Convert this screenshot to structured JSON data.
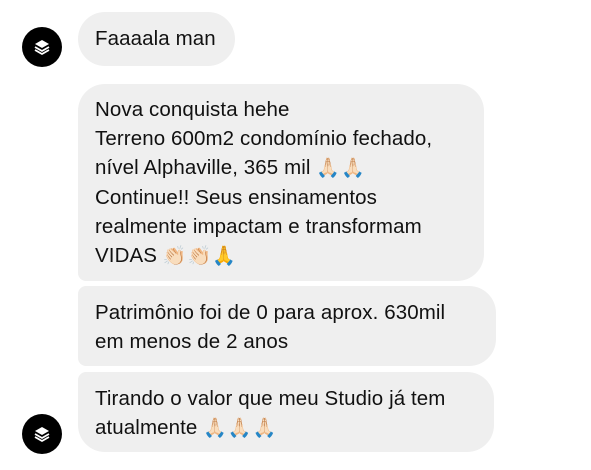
{
  "messages": [
    {
      "sender": "other",
      "lines": [
        {
          "text": "Faaaala man",
          "emoji": ""
        }
      ]
    },
    {
      "sender": "other",
      "lines": [
        {
          "text": "Nova conquista hehe",
          "emoji": ""
        },
        {
          "text": "Terreno 600m2 condomínio fechado,",
          "emoji": ""
        },
        {
          "text": "nível Alphaville, 365 mil",
          "emoji": "🙏🏻🙏🏻"
        },
        {
          "text": "Continue!! Seus ensinamentos",
          "emoji": ""
        },
        {
          "text": "realmente impactam e transformam",
          "emoji": ""
        },
        {
          "text": "VIDAS",
          "emoji": "👏🏻👏🏻🙏"
        }
      ]
    },
    {
      "sender": "other",
      "lines": [
        {
          "text": "Patrimônio foi de 0 para aprox. 630mil",
          "emoji": ""
        },
        {
          "text": "em menos de 2 anos",
          "emoji": ""
        }
      ]
    },
    {
      "sender": "other",
      "lines": [
        {
          "text": "Tirando o valor que meu Studio já tem",
          "emoji": ""
        },
        {
          "text": "atualmente",
          "emoji": "🙏🏻🙏🏻🙏🏻"
        }
      ]
    }
  ],
  "avatar_icon": "layers-icon",
  "colors": {
    "bubble": "#efefef",
    "avatar": "#000000",
    "text": "#111111"
  }
}
